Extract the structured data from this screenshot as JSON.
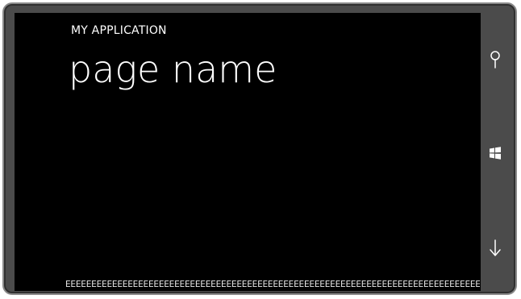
{
  "app": {
    "title": "MY APPLICATION",
    "page_name": "page name"
  },
  "content": {
    "bottom_text": "EEEEEEEEEEEEEEEEEEEEEEEEEEEEEEEEEEEEEEEEEEEEEEEEEEEEEEEEEEEEEEEEEEEEEEEEEEEEEEEEEEEEEEEEEEEEEEEEEEEEEEE"
  },
  "hardware_buttons": [
    {
      "icon": "search-icon"
    },
    {
      "icon": "windows-start-icon"
    },
    {
      "icon": "back-arrow-icon"
    }
  ],
  "colors": {
    "screen_background": "#000000",
    "text": "#ffffff",
    "bezel": "#4b4b4b"
  }
}
